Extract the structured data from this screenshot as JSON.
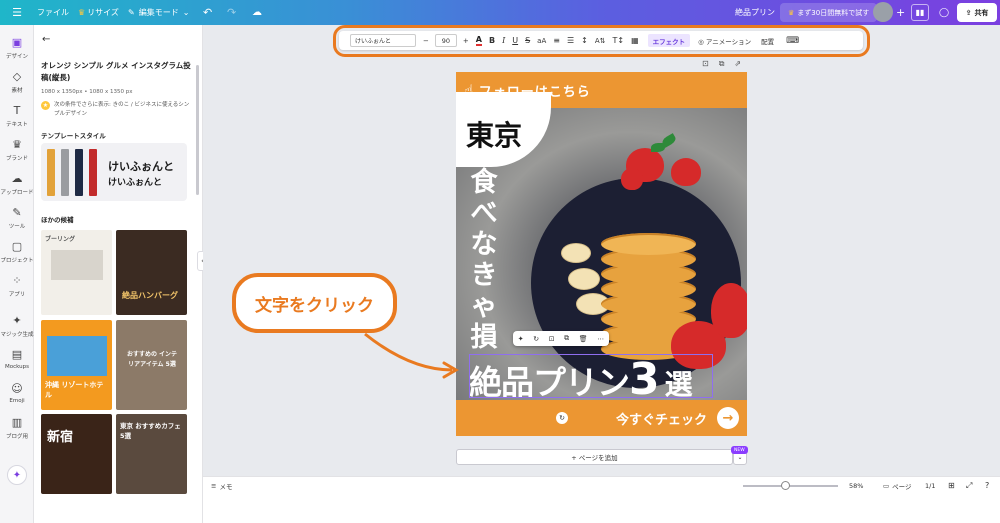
{
  "topbar": {
    "file": "ファイル",
    "resize": "リサイズ",
    "edit_mode": "編集モード",
    "design_title": "絶品プリン",
    "trial": "まず30日間無料で試す",
    "share": "共有"
  },
  "rail": [
    {
      "icon": "design-icon",
      "glyph": "▣",
      "label": "デザイン"
    },
    {
      "icon": "elements-icon",
      "glyph": "◇",
      "label": "素材"
    },
    {
      "icon": "text-icon",
      "glyph": "T",
      "label": "テキスト"
    },
    {
      "icon": "brand-icon",
      "glyph": "♛",
      "label": "ブランド"
    },
    {
      "icon": "upload-icon",
      "glyph": "☁",
      "label": "アップロード"
    },
    {
      "icon": "tools-icon",
      "glyph": "✎",
      "label": "ツール"
    },
    {
      "icon": "projects-icon",
      "glyph": "▢",
      "label": "プロジェクト"
    },
    {
      "icon": "apps-icon",
      "glyph": "⁘",
      "label": "アプリ"
    },
    {
      "icon": "magic-icon",
      "glyph": "✦",
      "label": "マジック生成"
    },
    {
      "icon": "mockups-icon",
      "glyph": "▤",
      "label": "Mockups"
    },
    {
      "icon": "emoji-icon",
      "glyph": "☺",
      "label": "Emoji"
    },
    {
      "icon": "blog-icon",
      "glyph": "▥",
      "label": "ブログ用"
    }
  ],
  "panel": {
    "title": "オレンジ シンプル グルメ インスタグラム投稿(縦長)",
    "dims": "1080 x 1350px • 1080 x 1350 px",
    "note": "次の条件でさらに表示: きのこ / ビジネスに使えるシンプルデザイン",
    "section_style": "テンプレートスタイル",
    "style_sample_1": "けいふぉんと",
    "style_sample_2": "けいふぉんと",
    "section_other": "ほかの候補",
    "thumbs": [
      "ブーリング",
      "絶品ハンバーグ",
      "沖縄 リゾートホテル",
      "おすすめの インテリアアイテム 5選",
      "新宿",
      "東京 おすすめカフェ 5選"
    ]
  },
  "toolbar": {
    "font": "けいふぉんと",
    "size": "90",
    "minus": "−",
    "plus": "+",
    "effects": "エフェクト",
    "animation": "アニメーション",
    "position": "配置"
  },
  "page": {
    "follow": "フォローはこちら",
    "tokyo": "東京",
    "vertical": "食べなきゃ損",
    "headline_main": "絶品プリン",
    "headline_num": "3",
    "headline_suffix": "選",
    "cta": "今すぐチェック"
  },
  "callout": "文字をクリック",
  "addpage": "+ ページを追加",
  "new_badge": "NEW",
  "status": {
    "memo": "メモ",
    "zoom": "58%",
    "pages": "ページ",
    "page_count": "1/1"
  }
}
